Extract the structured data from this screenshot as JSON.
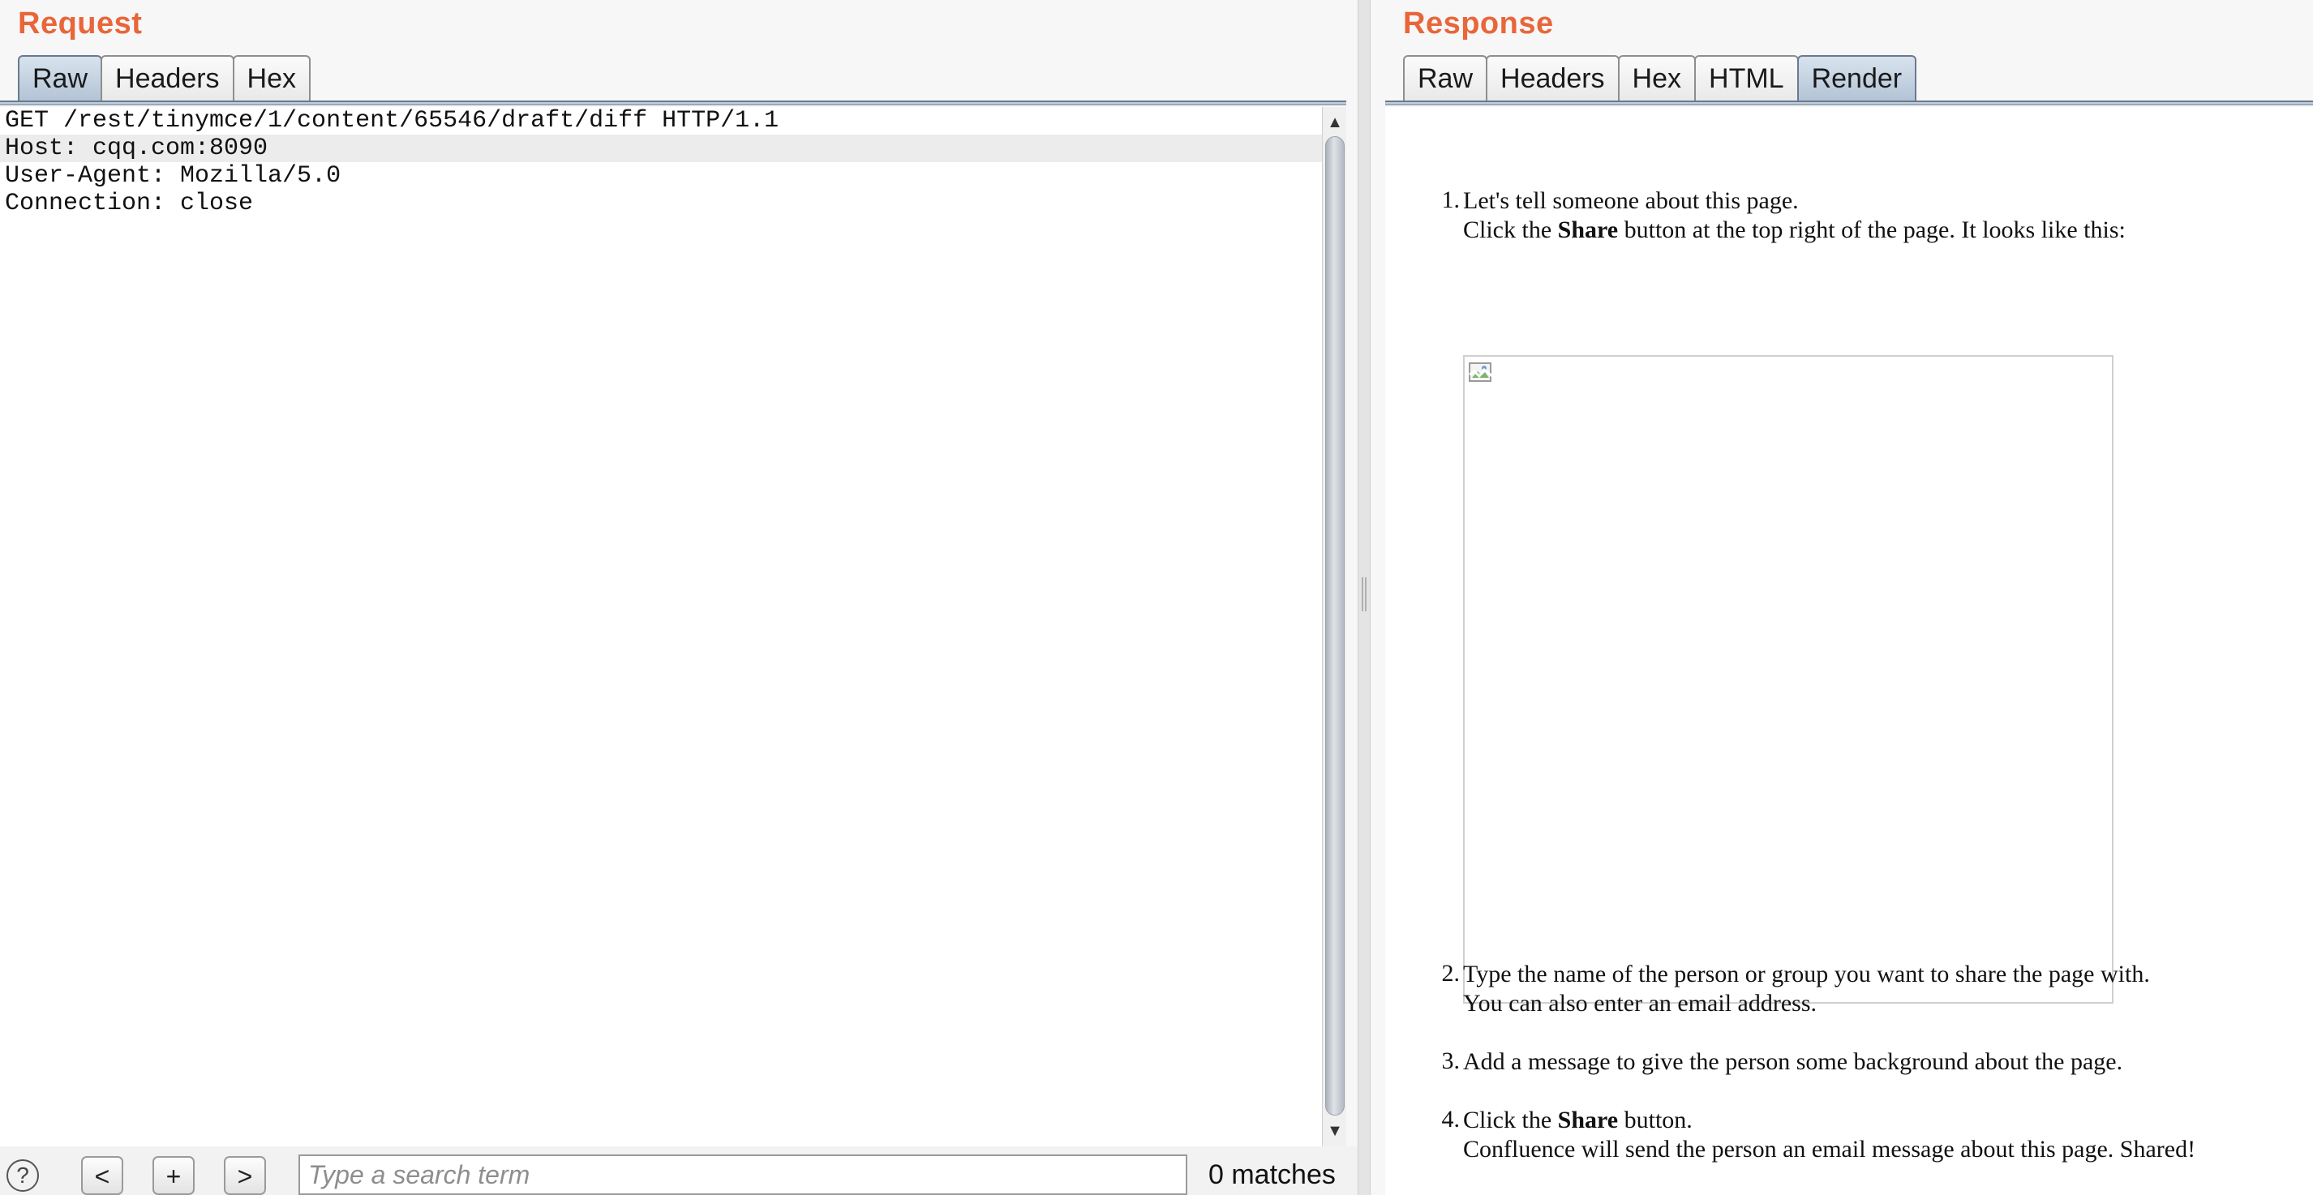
{
  "request": {
    "title": "Request",
    "tabs": [
      {
        "label": "Raw",
        "active": true
      },
      {
        "label": "Headers",
        "active": false
      },
      {
        "label": "Hex",
        "active": false
      }
    ],
    "lines": [
      "GET /rest/tinymce/1/content/65546/draft/diff HTTP/1.1",
      "Host: cqq.com:8090",
      "User-Agent: Mozilla/5.0",
      "Connection: close"
    ],
    "highlighted_line": 2
  },
  "search": {
    "help": "?",
    "prev": "<",
    "add": "+",
    "next": ">",
    "placeholder": "Type a search term",
    "matches": "0 matches"
  },
  "response": {
    "title": "Response",
    "tabs": [
      {
        "label": "Raw",
        "active": false
      },
      {
        "label": "Headers",
        "active": false
      },
      {
        "label": "Hex",
        "active": false
      },
      {
        "label": "HTML",
        "active": false
      },
      {
        "label": "Render",
        "active": true
      }
    ],
    "steps": [
      {
        "num": "1.",
        "line1": "Let's tell someone about this page.",
        "line2_pre": "Click the ",
        "line2_bold": "Share",
        "line2_post": " button at the top right of the page. It looks like this:"
      },
      {
        "num": "2.",
        "line1": "Type the name of the person or group you want to share the page with.",
        "line2": "You can also enter an email address."
      },
      {
        "num": "3.",
        "line1": "Add a message to give the person some background about the page."
      },
      {
        "num": "4.",
        "line1_pre": "Click the ",
        "line1_bold": "Share",
        "line1_post": " button.",
        "line2": "Confluence will send the person an email message about this page. Shared!"
      }
    ]
  },
  "colors": {
    "title_accent": "#e8663a",
    "active_tab": "#b3c4d6"
  }
}
